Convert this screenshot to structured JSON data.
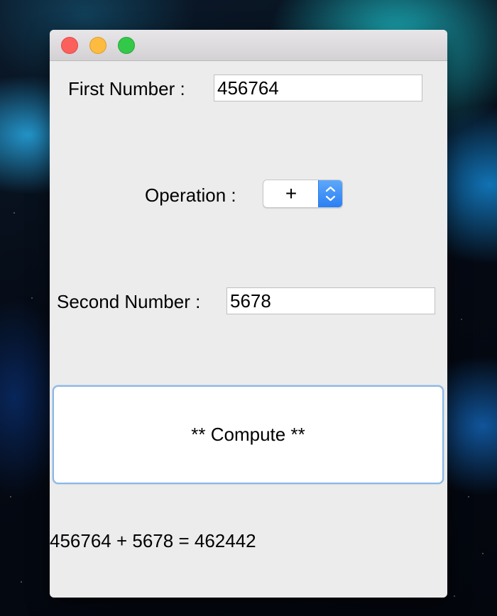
{
  "window": {
    "controls": [
      "close",
      "minimize",
      "zoom"
    ]
  },
  "form": {
    "first_number_label": "First Number :",
    "first_number_value": "456764",
    "operation_label": "Operation :",
    "operation_value": "+",
    "second_number_label": "Second Number :",
    "second_number_value": "5678",
    "compute_label": "** Compute **",
    "result_text": "456764 + 5678 = 462442"
  },
  "colors": {
    "window_bg": "#ececec",
    "close": "#fc605c",
    "minimize": "#fdbc40",
    "zoom": "#34c84a",
    "accent": "#2a7ff3",
    "button_focus_border": "#8cb6e6"
  },
  "icons": {
    "stepper": "chevron-up-down-icon"
  }
}
